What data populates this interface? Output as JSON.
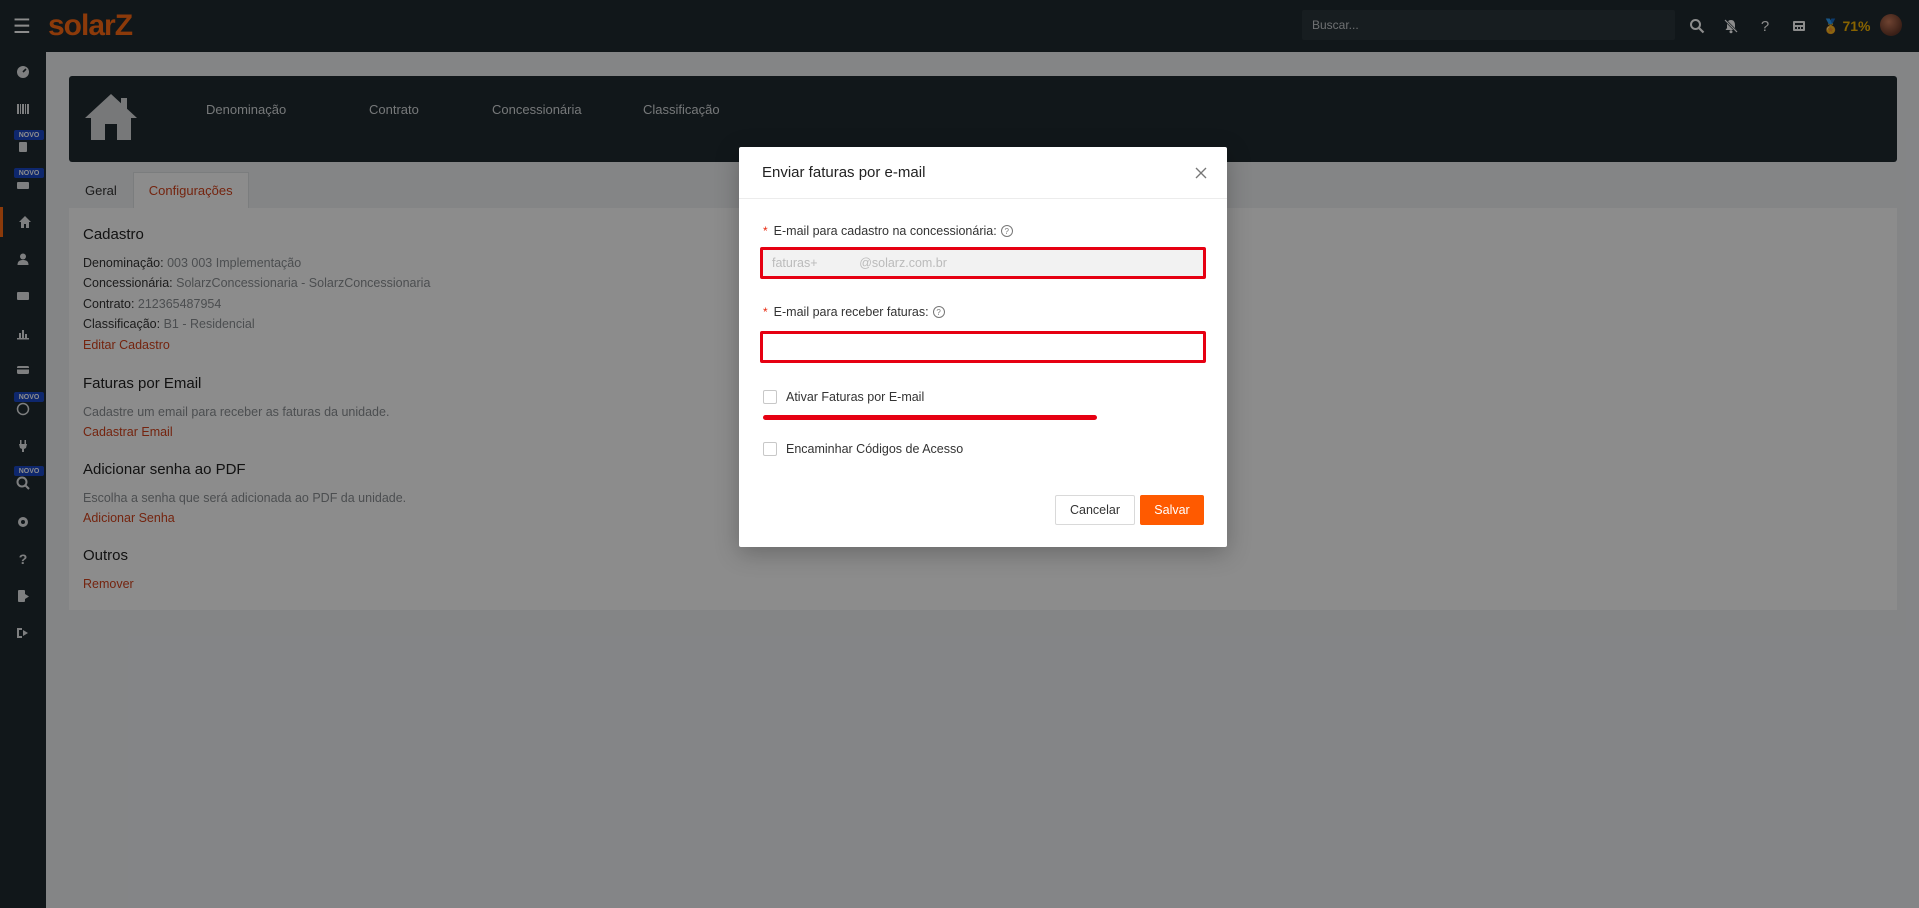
{
  "topbar": {
    "logo": "solarZ",
    "search_placeholder": "Buscar...",
    "percent": "71%"
  },
  "sidebar": {
    "novo_badge": "NOVO"
  },
  "banner": {
    "items": [
      "Denominação",
      "Contrato",
      "Concessionária",
      "Classificação"
    ]
  },
  "tabs": [
    "Geral",
    "Configurações"
  ],
  "cadastro": {
    "title": "Cadastro",
    "denominacao_label": "Denominação: ",
    "denominacao_value": "003 003 Implementação",
    "concessionaria_label": "Concessionária: ",
    "concessionaria_value": "SolarzConcessionaria - SolarzConcessionaria",
    "contrato_label": "Contrato: ",
    "contrato_value": "212365487954",
    "classificacao_label": "Classificação: ",
    "classificacao_value": "B1 - Residencial",
    "edit_link": "Editar Cadastro"
  },
  "faturas": {
    "title": "Faturas por Email",
    "description": "Cadastre um email para receber as faturas da unidade.",
    "link": "Cadastrar Email"
  },
  "senha": {
    "title": "Adicionar senha ao PDF",
    "description": "Escolha a senha que será adicionada ao PDF da unidade.",
    "link": "Adicionar Senha"
  },
  "outros": {
    "title": "Outros",
    "link": "Remover"
  },
  "modal": {
    "title": "Enviar faturas por e-mail",
    "field1_label": "E-mail para cadastro na concessionária:",
    "field1_value": "faturas+            @solarz.com.br",
    "field2_label": "E-mail para receber faturas:",
    "field2_value": "",
    "check1_label": "Ativar Faturas por E-mail",
    "check2_label": "Encaminhar Códigos de Acesso",
    "cancel": "Cancelar",
    "save": "Salvar",
    "required_mark": "*",
    "help_mark": "?"
  }
}
